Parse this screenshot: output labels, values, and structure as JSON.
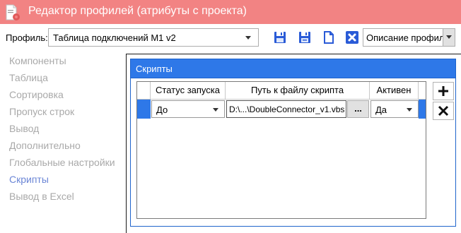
{
  "window": {
    "title": "Редактор профилей (атрибуты с проекта)"
  },
  "toolbar": {
    "profile_label": "Профиль:",
    "profile_value": "Таблица подключений М1 v2",
    "description_value": "Описание профиля:",
    "icons": [
      "save-icon",
      "save-as-icon",
      "new-document-icon",
      "delete-icon"
    ]
  },
  "sidebar": {
    "items": [
      {
        "label": "Компоненты"
      },
      {
        "label": "Таблица"
      },
      {
        "label": "Сортировка"
      },
      {
        "label": "Пропуск строк"
      },
      {
        "label": "Вывод"
      },
      {
        "label": "Дополнительно"
      },
      {
        "label": "Глобальные настройки"
      },
      {
        "label": "Скрипты",
        "active": true
      },
      {
        "label": "Вывод в Excel"
      }
    ]
  },
  "panel": {
    "title": "Скрипты",
    "columns": {
      "status": "Статус запуска",
      "path": "Путь к файлу скрипта",
      "active": "Активен"
    },
    "rows": [
      {
        "status": "До",
        "path": "D:\\...\\DoubleConnector_v1.vbs",
        "browse": "...",
        "active": "Да"
      }
    ]
  },
  "colors": {
    "titlebar": "#f28383",
    "accent_blue": "#2e78e8",
    "sidebar_active": "#6b86d6",
    "sidebar_inactive": "#a9a9a9"
  }
}
